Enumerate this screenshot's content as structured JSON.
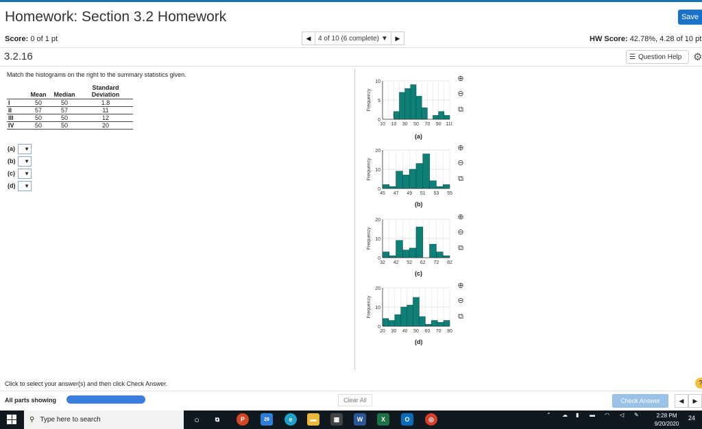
{
  "header": {
    "title": "Homework: Section 3.2 Homework",
    "save_label": "Save",
    "score_label": "Score:",
    "score_value": "0 of 1 pt",
    "nav_text": "4 of 10 (6 complete)",
    "nav_dropdown_glyph": "▼",
    "nav_prev_glyph": "◀",
    "nav_next_glyph": "▶",
    "hw_score_label": "HW Score:",
    "hw_score_value": "42.78%, 4.28 of 10 pts"
  },
  "question": {
    "number": "3.2.16",
    "help_label": "Question Help",
    "instruction": "Match the histograms on the right to the summary statistics given.",
    "table": {
      "headers": [
        "",
        "Mean",
        "Median",
        "Standard Deviation"
      ],
      "rows": [
        {
          "label": "I",
          "mean": "50",
          "median": "50",
          "sd": "1.8"
        },
        {
          "label": "II",
          "mean": "57",
          "median": "57",
          "sd": "11"
        },
        {
          "label": "III",
          "mean": "50",
          "median": "50",
          "sd": "12"
        },
        {
          "label": "IV",
          "mean": "50",
          "median": "50",
          "sd": "20"
        }
      ]
    },
    "answers": [
      {
        "label": "(a)"
      },
      {
        "label": "(b)"
      },
      {
        "label": "(c)"
      },
      {
        "label": "(d)"
      }
    ]
  },
  "chart_data": [
    {
      "type": "bar",
      "title": "(a)",
      "ylabel": "Frequency",
      "ylim": [
        0,
        10
      ],
      "yticks": [
        "0",
        "5",
        "10"
      ],
      "xticks": [
        "10",
        "10",
        "30",
        "50",
        "70",
        "90",
        "110"
      ],
      "values": [
        0,
        0,
        2,
        7,
        8,
        9,
        6,
        3,
        0,
        1,
        2,
        1
      ],
      "color": "#0e8077"
    },
    {
      "type": "bar",
      "title": "(b)",
      "ylabel": "Frequency",
      "ylim": [
        0,
        20
      ],
      "yticks": [
        "0",
        "10",
        "20"
      ],
      "xticks": [
        "45",
        "47",
        "49",
        "51",
        "53",
        "55"
      ],
      "values": [
        2,
        1,
        9,
        7,
        10,
        13,
        18,
        4,
        1,
        2
      ],
      "color": "#0e8077"
    },
    {
      "type": "bar",
      "title": "(c)",
      "ylabel": "Frequency",
      "ylim": [
        0,
        20
      ],
      "yticks": [
        "0",
        "10",
        "20"
      ],
      "xticks": [
        "32",
        "42",
        "52",
        "62",
        "72",
        "82"
      ],
      "values": [
        3,
        1,
        9,
        4,
        5,
        16,
        0,
        7,
        3,
        1
      ],
      "color": "#0e8077"
    },
    {
      "type": "bar",
      "title": "(d)",
      "ylabel": "Frequency",
      "ylim": [
        0,
        20
      ],
      "yticks": [
        "0",
        "10",
        "20"
      ],
      "xticks": [
        "20",
        "30",
        "40",
        "50",
        "60",
        "70",
        "80"
      ],
      "values": [
        4,
        3,
        6,
        10,
        11,
        15,
        5,
        1,
        3,
        2,
        3
      ],
      "color": "#0e8077"
    }
  ],
  "footer": {
    "instruction": "Click to select your answer(s) and then click Check Answer.",
    "parts_label": "All parts showing",
    "clear_label": "Clear All",
    "check_label": "Check Answer"
  },
  "taskbar": {
    "search_placeholder": "Type here to search",
    "time": "2:28 PM",
    "date": "9/20/2020",
    "badge": "24",
    "ppt_badge": "28"
  },
  "colors": {
    "accent": "#1a73c8",
    "bar": "#0e8077"
  }
}
